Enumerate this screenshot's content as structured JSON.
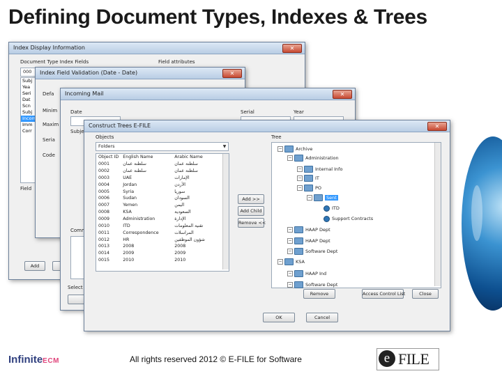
{
  "slide": {
    "title": "Defining Document Types, Indexes & Trees",
    "footer": "All rights reserved 2012 © E-FILE for Software",
    "logo_left_main": "Infinite",
    "logo_left_accent": "ECM",
    "logo_right_e": "e",
    "logo_right_text": "FILE"
  },
  "window_index_display": {
    "title": "Index Display Information",
    "label_doc_type_fields": "Document Type Index Fields",
    "label_field_attributes": "Field attributes",
    "list_items": [
      "Subj",
      "Yea",
      "Seri",
      "Dat",
      "Scn",
      "Subj",
      "Incom",
      "Imm",
      "Corr"
    ],
    "field_label": "Field",
    "btn_add": "Add",
    "combo_value": "000"
  },
  "window_validation": {
    "title": "Index Field Validation (Date - Date)",
    "label_default": "Defa",
    "label_minimum": "Minim",
    "label_maximum": "Maxim",
    "label_serial": "Seria",
    "label_code": "Code"
  },
  "window_incoming_mail": {
    "title": "Incoming Mail",
    "label_date": "Date",
    "label_subject": "Subje",
    "label_serial": "Serial",
    "label_year": "Year",
    "label_comments": "Comm",
    "label_select": "Select"
  },
  "window_trees": {
    "title": "Construct Trees E-FILE",
    "label_objects": "Objects",
    "objects_select": "Folders",
    "label_tree": "Tree",
    "col_object_id": "Object ID",
    "col_english_name": "English Name",
    "col_arabic_name": "Arabic Name",
    "rows": [
      {
        "id": "0001",
        "en": "سلطنة عمان",
        "ar": "سلطنة عمان"
      },
      {
        "id": "0002",
        "en": "سلطنة عمان",
        "ar": "سلطنة عمان"
      },
      {
        "id": "0003",
        "en": "UAE",
        "ar": "الإمارات"
      },
      {
        "id": "0004",
        "en": "Jordan",
        "ar": "الأردن"
      },
      {
        "id": "0005",
        "en": "Syria",
        "ar": "سوريا"
      },
      {
        "id": "0006",
        "en": "Sudan",
        "ar": "السودان"
      },
      {
        "id": "0007",
        "en": "Yemen",
        "ar": "اليمن"
      },
      {
        "id": "0008",
        "en": "KSA",
        "ar": "السعودية"
      },
      {
        "id": "0009",
        "en": "Administration",
        "ar": "الإدارة"
      },
      {
        "id": "0010",
        "en": "ITD",
        "ar": "تقنية المعلومات"
      },
      {
        "id": "0011",
        "en": "Correspondence",
        "ar": "المراسلات"
      },
      {
        "id": "0012",
        "en": "HR",
        "ar": "شؤون الموظفين"
      },
      {
        "id": "0013",
        "en": "2008",
        "ar": "2008"
      },
      {
        "id": "0014",
        "en": "2009",
        "ar": "2009"
      },
      {
        "id": "0015",
        "en": "2010",
        "ar": "2010"
      }
    ],
    "btn_add": "Add >>",
    "btn_add_child": "Add Child",
    "btn_remove": "Remove <<",
    "tree_nodes": [
      {
        "label": "Archive"
      },
      {
        "label": "Administration"
      },
      {
        "label": "Internal Info"
      },
      {
        "label": "IT"
      },
      {
        "label": "PO"
      },
      {
        "label": "Sent"
      },
      {
        "label": "ITD"
      },
      {
        "label": "Support Contracts"
      },
      {
        "label": "HAAP Dept"
      },
      {
        "label": "HAAP Dept"
      },
      {
        "label": "Software Dept"
      },
      {
        "label": "KSA"
      },
      {
        "label": "HAAP Ind"
      },
      {
        "label": "Software Dept"
      }
    ],
    "btn_remove_node": "Remove",
    "btn_access_control": "Access Control List",
    "btn_close": "Close",
    "btn_ok": "OK",
    "btn_cancel": "Cancel"
  },
  "colors": {
    "title_text": "#1a1a1a",
    "window_bg": "#f0f0f0",
    "close_button": "#c74a33",
    "highlight_row": "#3399ff",
    "logo_blue": "#2f3f7e",
    "logo_pink": "#e0457b"
  }
}
